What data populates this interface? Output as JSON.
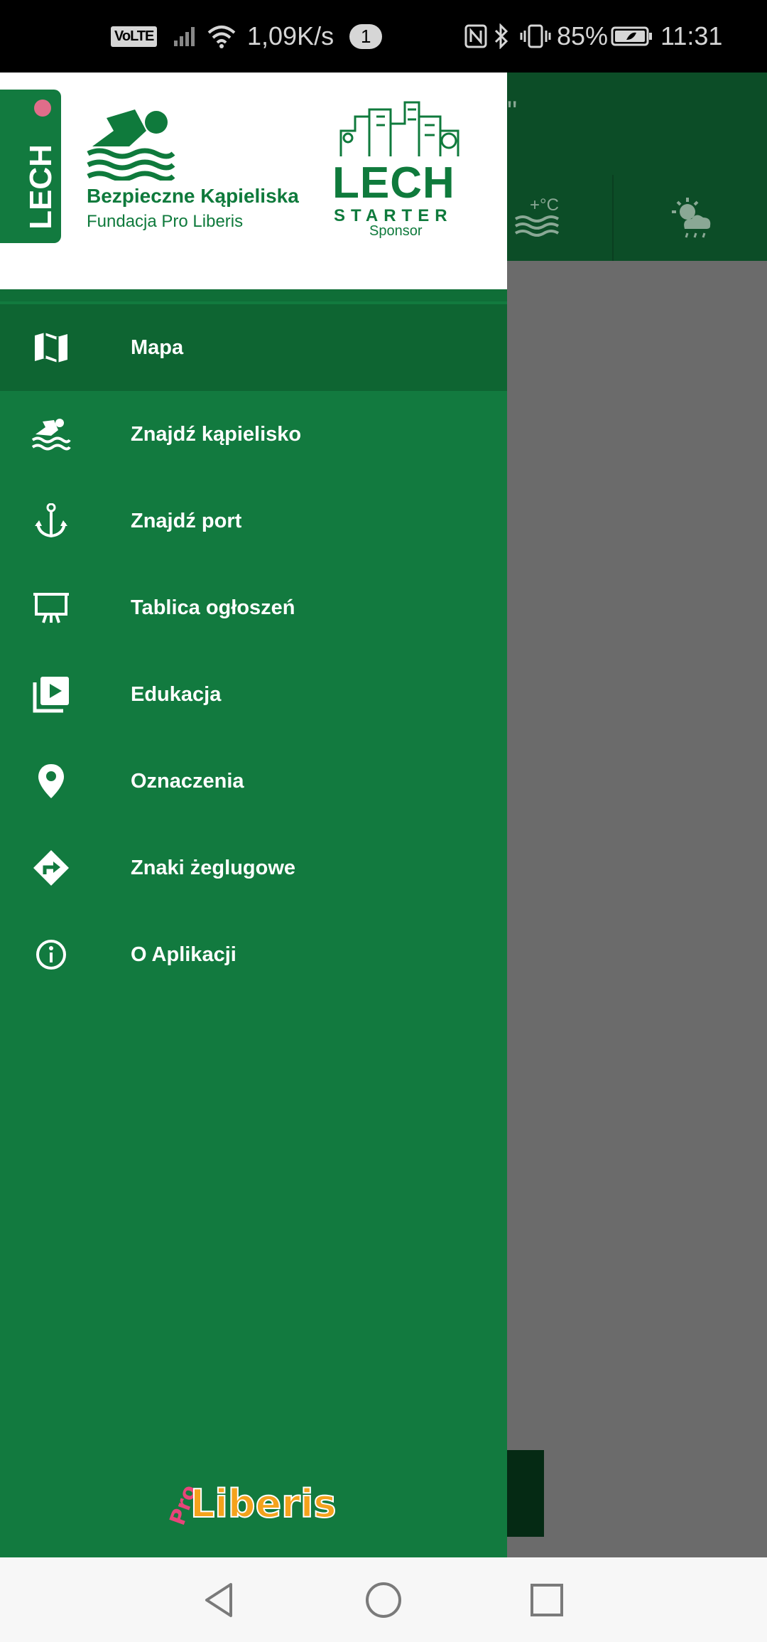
{
  "status_bar": {
    "volte": "VoLTE",
    "speed": "1,09K/s",
    "notification_count": "1",
    "battery_percent": "85%",
    "time": "11:31",
    "icons": [
      "signal-icon",
      "wifi-icon",
      "nfc-icon",
      "bluetooth-icon",
      "vibrate-icon",
      "battery-icon"
    ]
  },
  "background_app": {
    "title_fragment": "\"",
    "tab_icons": [
      "water-temperature-icon",
      "weather-icon"
    ]
  },
  "drawer": {
    "header": {
      "lech_logo_text": "LECH",
      "brand_title": "Bezpieczne Kąpieliska",
      "brand_subtitle": "Fundacja Pro Liberis",
      "starter_title": "LECH",
      "starter_word": "STARTER",
      "starter_sponsor": "Sponsor"
    },
    "items": [
      {
        "label": "Mapa",
        "icon": "map-icon",
        "active": true
      },
      {
        "label": "Znajdź kąpielisko",
        "icon": "swimmer-icon",
        "active": false
      },
      {
        "label": "Znajdź port",
        "icon": "anchor-icon",
        "active": false
      },
      {
        "label": "Tablica ogłoszeń",
        "icon": "presentation-board-icon",
        "active": false
      },
      {
        "label": "Edukacja",
        "icon": "video-library-icon",
        "active": false
      },
      {
        "label": "Oznaczenia",
        "icon": "location-pin-icon",
        "active": false
      },
      {
        "label": "Znaki żeglugowe",
        "icon": "turn-sign-icon",
        "active": false
      },
      {
        "label": "O Aplikacji",
        "icon": "info-icon",
        "active": false
      }
    ],
    "footer_logo": {
      "pro": "Pro",
      "liberis": "Liberis"
    }
  },
  "nav_bar": {
    "buttons": [
      "back-icon",
      "home-icon",
      "recents-icon"
    ]
  },
  "colors": {
    "drawer": "#127a3f",
    "drawer_active": "#0e6532",
    "scrim": "#6b6b6b",
    "header_bg": "#ffffff",
    "brand_green": "#0f7a3c"
  }
}
